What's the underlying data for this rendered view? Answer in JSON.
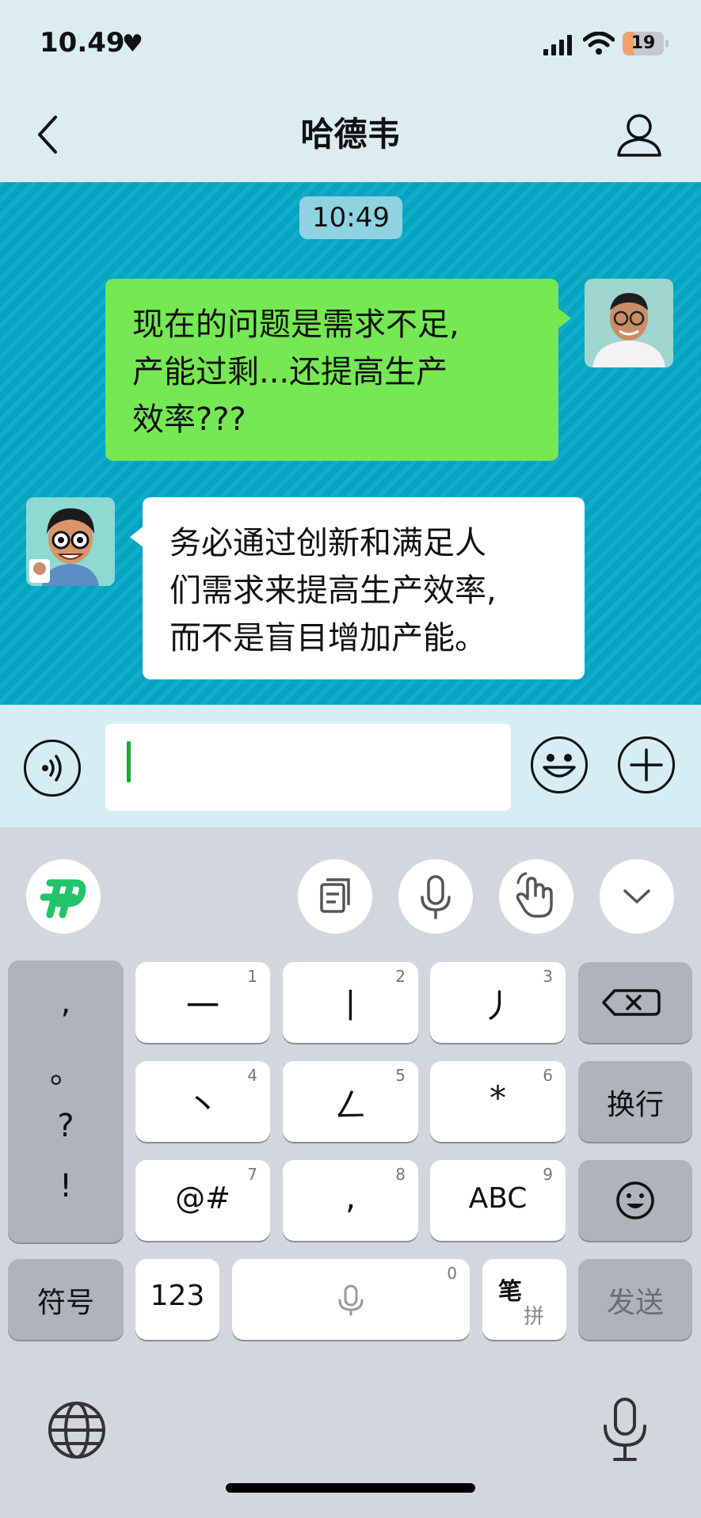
{
  "status": {
    "time": "10.49",
    "battery": "19"
  },
  "nav": {
    "title": "哈德韦"
  },
  "chat": {
    "timestamp": "10:49",
    "messages": [
      {
        "sender": "me",
        "lines": [
          "现在的问题是需求不足,",
          "产能过剩...还提高生产",
          "效率???"
        ]
      },
      {
        "sender": "bot",
        "lines": [
          "务必通过创新和满足人",
          "们需求来提高生产效率,",
          "而不是盲目增加产能。"
        ]
      }
    ]
  },
  "input": {
    "value": ""
  },
  "keyboard": {
    "punctuation": [
      ",",
      "。",
      "?",
      "!"
    ],
    "keys": {
      "k1": {
        "label": "一",
        "hint": "1"
      },
      "k2": {
        "label": "丨",
        "hint": "2"
      },
      "k3": {
        "label": "丿",
        "hint": "3"
      },
      "k4": {
        "label": "丶",
        "hint": "4"
      },
      "k5": {
        "label": "ㄥ",
        "hint": "5"
      },
      "k6": {
        "label": "*",
        "hint": "6"
      },
      "k7": {
        "label": "@#",
        "hint": "7"
      },
      "k8": {
        "label": ",",
        "hint": "8"
      },
      "k9": {
        "label": "ABC",
        "hint": "9"
      },
      "k0": {
        "hint": "0"
      }
    },
    "newline": "换行",
    "symbols": "符号",
    "numbers": "123",
    "stroke_top": "笔",
    "stroke_bottom": "拼",
    "send": "发送"
  },
  "colors": {
    "sent_bubble": "#75e854",
    "chat_bg": "#05a9c7",
    "caret": "#1ba83b",
    "logo": "#22c36a"
  }
}
